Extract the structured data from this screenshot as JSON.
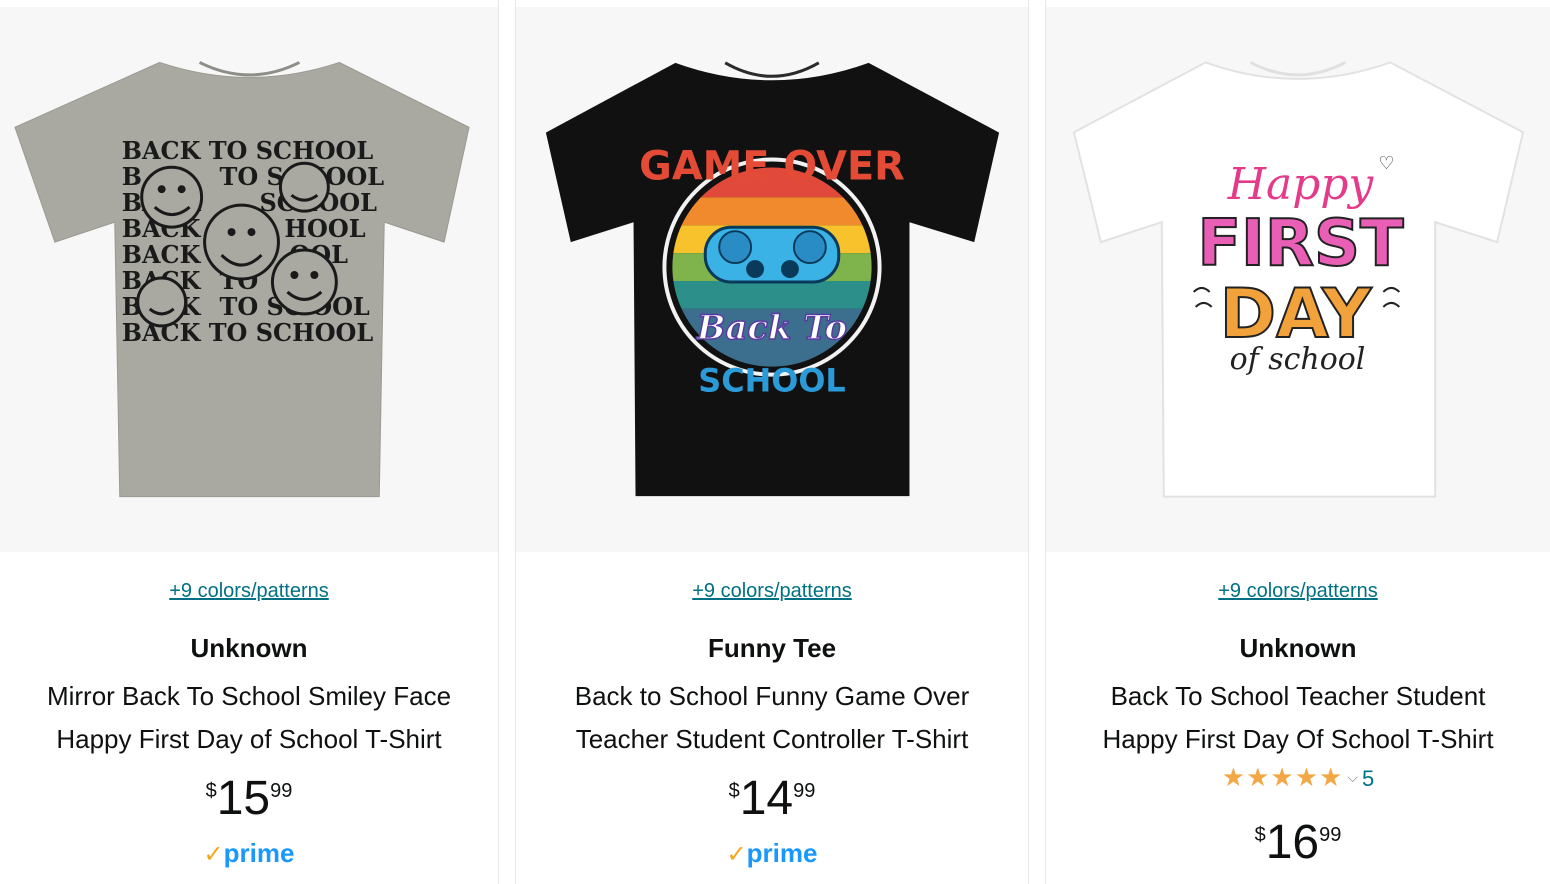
{
  "products": [
    {
      "swatch_text": "+9 colors/patterns",
      "brand": "Unknown",
      "title_line1": "Mirror Back To School Smiley Face",
      "title_line2": "Happy First Day of School T-Shirt",
      "price_symbol": "$",
      "price_whole": "15",
      "price_fraction": "99",
      "prime_label": "prime",
      "shirt_color": "#a9a9a2",
      "print_text": "BACK TO SCHOOL"
    },
    {
      "swatch_text": "+9 colors/patterns",
      "brand": "Funny Tee",
      "title_line1": "Back to School Funny Game Over",
      "title_line2": "Teacher Student Controller T-Shirt",
      "price_symbol": "$",
      "price_whole": "14",
      "price_fraction": "99",
      "prime_label": "prime",
      "shirt_color": "#111111",
      "print_top": "GAME OVER",
      "print_mid": "Back To",
      "print_bottom": "SCHOOL"
    },
    {
      "swatch_text": "+9 colors/patterns",
      "brand": "Unknown",
      "title_line1": "Back To School Teacher Student",
      "title_line2": "Happy First Day Of School T-Shirt",
      "rating_stars": "★★★★★",
      "rating_value": 5,
      "rating_count": "5",
      "price_symbol": "$",
      "price_whole": "16",
      "price_fraction": "99",
      "shirt_color": "#ffffff",
      "print_top": "Happy",
      "print_mid1": "FIRST",
      "print_mid2": "DAY",
      "print_bottom": "of school"
    }
  ],
  "colors": {
    "link": "#007185",
    "star": "#f3a847",
    "prime_blue": "#1a98ff",
    "prime_check": "#f7a51c"
  },
  "icons": {
    "prime_check": "checkmark-icon",
    "rating_dropdown": "chevron-down-icon",
    "star": "star-icon"
  }
}
